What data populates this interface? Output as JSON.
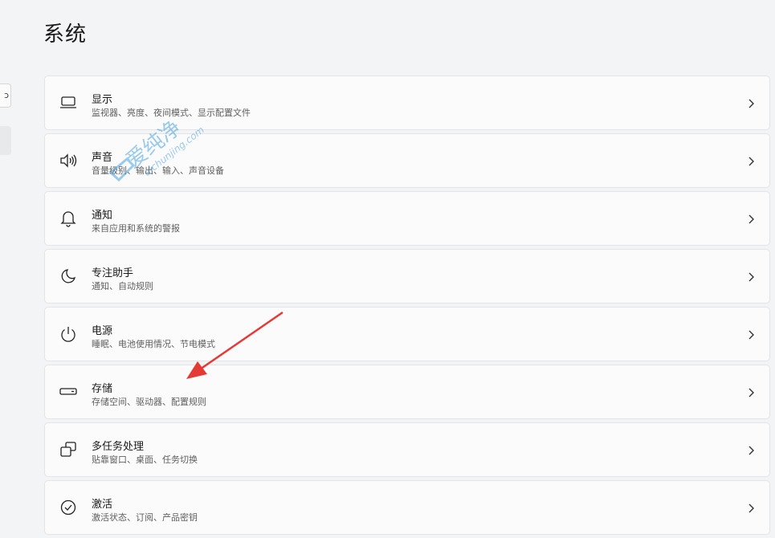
{
  "page": {
    "title": "系统"
  },
  "left_stub": {
    "glyph": "ↄ"
  },
  "settings": [
    {
      "key": "display",
      "icon": "monitor-icon",
      "title": "显示",
      "subtitle": "监视器、亮度、夜间模式、显示配置文件"
    },
    {
      "key": "sound",
      "icon": "speaker-icon",
      "title": "声音",
      "subtitle": "音量级别、输出、输入、声音设备"
    },
    {
      "key": "notifications",
      "icon": "bell-icon",
      "title": "通知",
      "subtitle": "来自应用和系统的警报"
    },
    {
      "key": "focus-assist",
      "icon": "moon-icon",
      "title": "专注助手",
      "subtitle": "通知、自动规则"
    },
    {
      "key": "power",
      "icon": "power-icon",
      "title": "电源",
      "subtitle": "睡眠、电池使用情况、节电模式"
    },
    {
      "key": "storage",
      "icon": "drive-icon",
      "title": "存储",
      "subtitle": "存储空间、驱动器、配置规则"
    },
    {
      "key": "multitasking",
      "icon": "windows-stack-icon",
      "title": "多任务处理",
      "subtitle": "贴靠窗口、桌面、任务切换"
    },
    {
      "key": "activation",
      "icon": "check-circle-icon",
      "title": "激活",
      "subtitle": "激活状态、订阅、产品密钥"
    }
  ],
  "watermark": {
    "brand": "爱纯净",
    "site": "aichunjing.com"
  },
  "colors": {
    "annotation_arrow": "#e53935",
    "watermark": "#4aa3df"
  }
}
